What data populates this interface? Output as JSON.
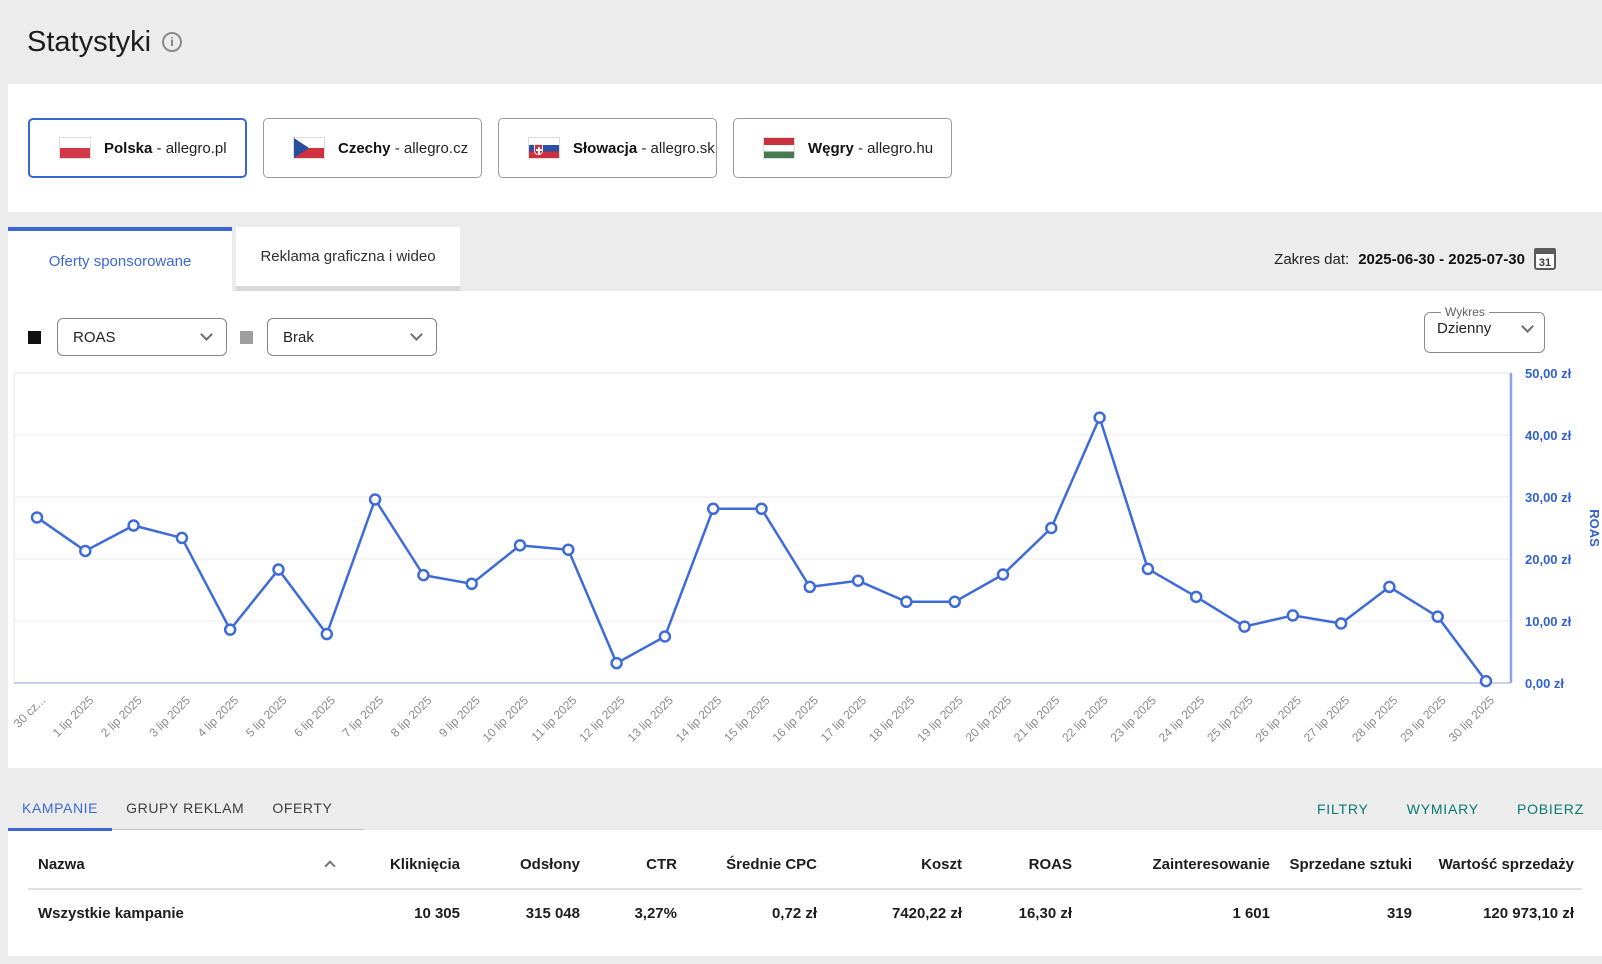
{
  "header": {
    "title": "Statystyki"
  },
  "markets": [
    {
      "name": "Polska",
      "suffix": "- allegro.pl",
      "selected": true
    },
    {
      "name": "Czechy",
      "suffix": "- allegro.cz",
      "selected": false
    },
    {
      "name": "Słowacja",
      "suffix": "- allegro.sk",
      "selected": false
    },
    {
      "name": "Węgry",
      "suffix": "- allegro.hu",
      "selected": false
    }
  ],
  "tabs": [
    {
      "label": "Oferty sponsorowane",
      "active": true
    },
    {
      "label": "Reklama graficzna i wideo",
      "active": false
    }
  ],
  "date_range": {
    "label": "Zakres dat:",
    "value": "2025-06-30 - 2025-07-30",
    "calendar_day": "31"
  },
  "controls": {
    "metric_primary": "ROAS",
    "metric_secondary": "Brak",
    "chart_type_label": "Wykres",
    "chart_type_value": "Dzienny",
    "swatch_primary_color": "#111111",
    "swatch_secondary_color": "#9e9e9e"
  },
  "colors": {
    "accent_blue": "#3b67d6",
    "chart_line": "#3f6bd8",
    "axis_label_blue": "#3160d0",
    "teal": "#067a6f"
  },
  "chart_data": {
    "type": "line",
    "title": "",
    "xlabel": "",
    "ylabel": "ROAS",
    "ylim": [
      0,
      50
    ],
    "grid": true,
    "legend_position": "none",
    "x": [
      "30 cz...",
      "1 lip 2025",
      "2 lip 2025",
      "3 lip 2025",
      "4 lip 2025",
      "5 lip 2025",
      "6 lip 2025",
      "7 lip 2025",
      "8 lip 2025",
      "9 lip 2025",
      "10 lip 2025",
      "11 lip 2025",
      "12 lip 2025",
      "13 lip 2025",
      "14 lip 2025",
      "15 lip 2025",
      "16 lip 2025",
      "17 lip 2025",
      "18 lip 2025",
      "19 lip 2025",
      "20 lip 2025",
      "21 lip 2025",
      "22 lip 2025",
      "23 lip 2025",
      "24 lip 2025",
      "25 lip 2025",
      "26 lip 2025",
      "27 lip 2025",
      "28 lip 2025",
      "29 lip 2025",
      "30 lip 2025"
    ],
    "series": [
      {
        "name": "ROAS",
        "unit": "zł",
        "color": "#3f6bd8",
        "values": [
          26.7,
          21.3,
          25.4,
          23.4,
          8.6,
          18.3,
          7.9,
          29.6,
          17.4,
          16.0,
          22.2,
          21.5,
          3.2,
          7.5,
          28.1,
          28.1,
          15.5,
          16.5,
          13.1,
          13.1,
          17.5,
          25.0,
          42.8,
          18.4,
          13.9,
          9.1,
          10.9,
          9.6,
          15.5,
          10.7,
          0.3
        ]
      }
    ],
    "y_ticks": [
      {
        "value": 0,
        "label": "0,00 zł"
      },
      {
        "value": 10,
        "label": "10,00 zł"
      },
      {
        "value": 20,
        "label": "20,00 zł"
      },
      {
        "value": 30,
        "label": "30,00 zł"
      },
      {
        "value": 40,
        "label": "40,00 zł"
      },
      {
        "value": 50,
        "label": "50,00 zł"
      }
    ]
  },
  "table_tabs": [
    {
      "label": "KAMPANIE",
      "active": true
    },
    {
      "label": "GRUPY REKLAM",
      "active": false
    },
    {
      "label": "OFERTY",
      "active": false
    }
  ],
  "table_actions": [
    {
      "label": "FILTRY"
    },
    {
      "label": "WYMIARY"
    },
    {
      "label": "POBIERZ"
    }
  ],
  "table": {
    "columns": [
      "Nazwa",
      "Kliknięcia",
      "Odsłony",
      "CTR",
      "Średnie CPC",
      "Koszt",
      "ROAS",
      "Zainteresowanie",
      "Sprzedane sztuki",
      "Wartość sprzedaży"
    ],
    "rows": [
      [
        "Wszystkie kampanie",
        "10 305",
        "315 048",
        "3,27%",
        "0,72 zł",
        "7420,22 zł",
        "16,30 zł",
        "1 601",
        "319",
        "120 973,10 zł"
      ]
    ]
  }
}
